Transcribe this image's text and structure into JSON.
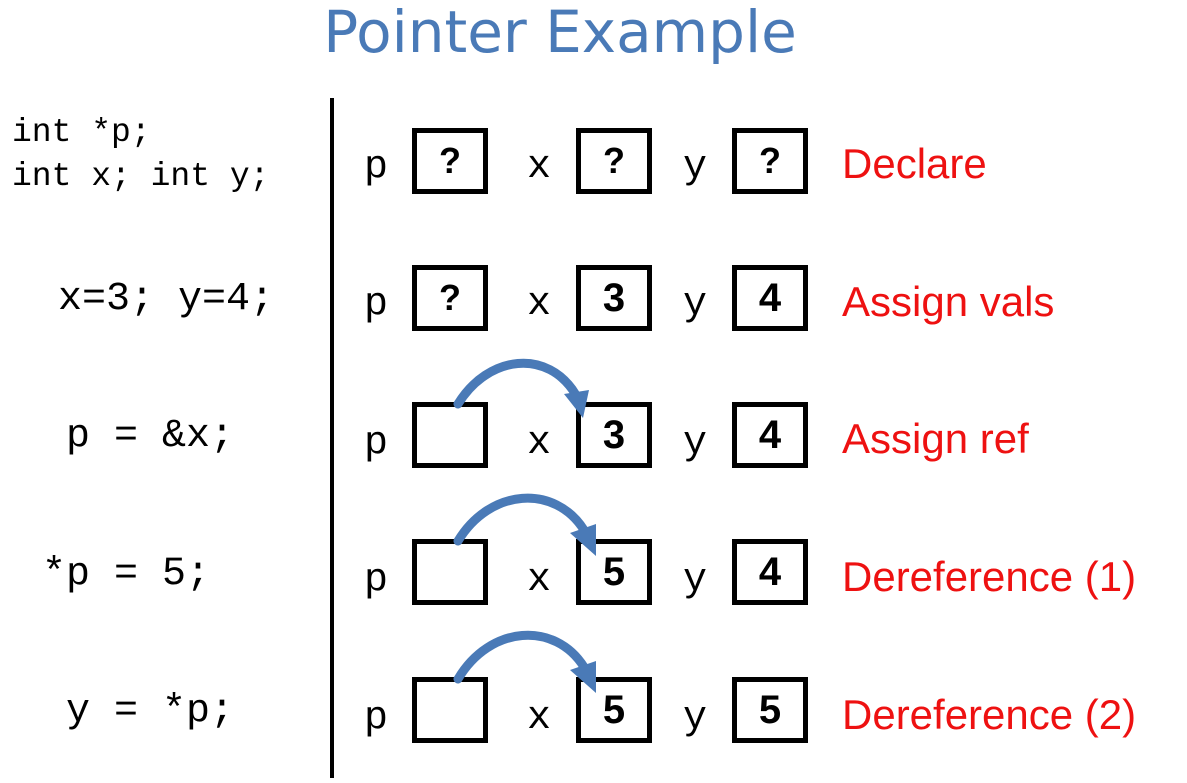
{
  "title": "Pointer Example",
  "rows": [
    {
      "code": [
        "int *p;",
        "int x; int y;"
      ],
      "p": "?",
      "x": "?",
      "y": "?",
      "label": "Declare"
    },
    {
      "code": [
        "x=3; y=4;"
      ],
      "p": "?",
      "x": "3",
      "y": "4",
      "label": "Assign vals"
    },
    {
      "code": [
        "p = &x;"
      ],
      "p": "",
      "x": "3",
      "y": "4",
      "label": "Assign ref"
    },
    {
      "code": [
        "*p = 5;"
      ],
      "p": "",
      "x": "5",
      "y": "4",
      "label": "Dereference (1)"
    },
    {
      "code": [
        "y = *p;"
      ],
      "p": "",
      "x": "5",
      "y": "5",
      "label": "Dereference (2)"
    }
  ],
  "var_names": {
    "p": "p",
    "x": "x",
    "y": "y"
  },
  "colors": {
    "title": "#4a7ab7",
    "label": "#ee1111",
    "arrow": "#4a7ab7"
  }
}
